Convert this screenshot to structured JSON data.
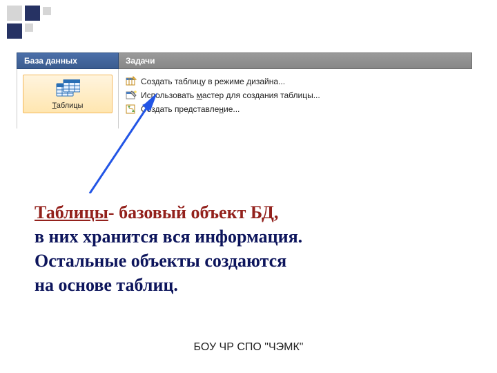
{
  "headers": {
    "database": "База данных",
    "tasks": "Задачи"
  },
  "sidebar": {
    "tables_prefix": "Т",
    "tables_rest": "аблицы"
  },
  "tasks": {
    "items": [
      {
        "prefix": "Создать таблицу в режиме ",
        "u": "д",
        "suffix": "изайна..."
      },
      {
        "prefix": "Использовать ",
        "u": "м",
        "suffix": "астер для создания таблицы..."
      },
      {
        "prefix": "Создать представле",
        "u": "н",
        "suffix": "ие..."
      }
    ]
  },
  "explain": {
    "term": "Таблицы",
    "line1": "-  базовый объект БД,",
    "line2": " в них хранится вся информация.",
    "line3": " Остальные объекты создаются",
    "line4": "на основе таблиц."
  },
  "footer": "БОУ  ЧР СПО \"ЧЭМК\""
}
